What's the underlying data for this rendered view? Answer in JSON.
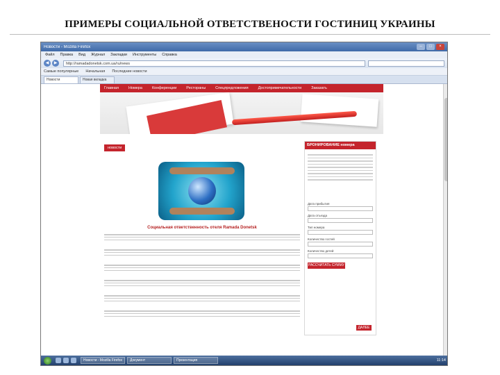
{
  "slide": {
    "title": "ПРИМЕРЫ СОЦИАЛЬНОЙ ОТВЕТСТВЕНОСТИ ГОСТИНИЦ УКРАИНЫ"
  },
  "browser": {
    "window_title": "Новости - Mozilla Firefox",
    "menu": [
      "Файл",
      "Правка",
      "Вид",
      "Журнал",
      "Закладки",
      "Инструменты",
      "Справка"
    ],
    "url": "http://ramadadonetsk.com.ua/ru/news",
    "bookmarks": [
      "Самые популярные",
      "Начальная",
      "Последние новости"
    ],
    "tabs": [
      "Новости",
      "Новая вкладка"
    ]
  },
  "site": {
    "nav": [
      "Главная",
      "Номера",
      "Конференции",
      "Рестораны",
      "Спецпредложения",
      "Достопримечательности",
      "Заказать"
    ],
    "news_label": "новости",
    "article_title": "Социальная ответственность отеля Ramada Donetsk"
  },
  "sidebar": {
    "heading": "БРОНИРОВАНИЕ номера",
    "fields": [
      "Дата прибытия",
      "Дата отъезда",
      "Тип номера",
      "Количество гостей",
      "Количество детей"
    ],
    "calc_button": "РАССЧИТАТЬ СУММУ",
    "more_button": "ДАЛЕЕ"
  },
  "taskbar": {
    "tasks": [
      "Новости - Mozilla Firefox",
      "Документ",
      "Презентация"
    ],
    "clock": "11:14"
  }
}
